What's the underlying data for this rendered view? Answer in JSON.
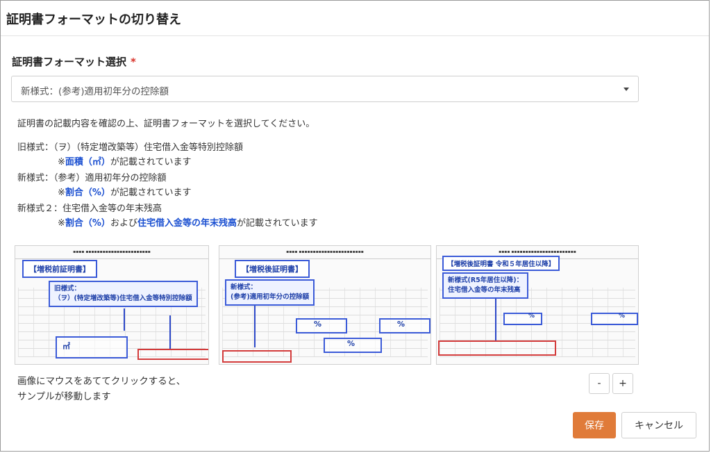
{
  "dialog": {
    "title": "証明書フォーマットの切り替え"
  },
  "form": {
    "label": "証明書フォーマット選択",
    "required_mark": "*",
    "selected_value": "新様式：(参考)適用初年分の控除額"
  },
  "instructions": {
    "intro": "証明書の記載内容を確認の上、証明書フォーマットを選択してください。",
    "formats": [
      {
        "title": "旧様式：（ヲ）（特定増改築等）住宅借入金等特別控除額",
        "note_prefix": "※",
        "note_highlight": "面積（㎡）",
        "note_suffix": "が記載されています"
      },
      {
        "title": "新様式：（参考）適用初年分の控除額",
        "note_prefix": "※",
        "note_highlight": "割合（%）",
        "note_suffix": "が記載されています"
      },
      {
        "title": "新様式２：住宅借入金等の年末残高",
        "note_prefix": "※",
        "note_highlight": "割合（%）",
        "note_middle": "および",
        "note_highlight2": "住宅借入金等の年末残高",
        "note_suffix": "が記載されています"
      }
    ]
  },
  "samples": [
    {
      "tag": "【増税前証明書】",
      "callout_line1": "旧様式：",
      "callout_line2": "（ヲ）(特定増改築等)住宅借入金等特別控除額",
      "mark": "㎡"
    },
    {
      "tag": "【増税後証明書】",
      "callout_line1": "新様式：",
      "callout_line2": "(参考)適用初年分の控除額",
      "mark": "%"
    },
    {
      "tag": "【増税後証明書 令和５年居住以降】",
      "callout_line1": "新様式(R5年居住以降)：",
      "callout_line2": "住宅借入金等の年末残高",
      "mark": "%"
    }
  ],
  "hint": {
    "line1": "画像にマウスをあててクリックすると、",
    "line2": "サンプルが移動します"
  },
  "zoom": {
    "minus": "-",
    "plus": "+"
  },
  "buttons": {
    "save": "保存",
    "cancel": "キャンセル"
  },
  "colors": {
    "primary": "#e07b39",
    "highlight": "#1a4fd1",
    "required": "#d9342b"
  }
}
